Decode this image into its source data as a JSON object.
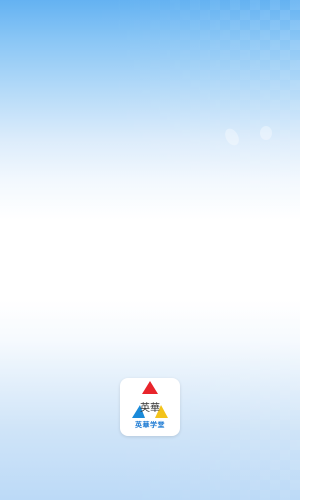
{
  "splash": {
    "app_name": "英華学堂",
    "logo_glyphs": "英華"
  },
  "colors": {
    "brand_blue": "#1e7bd3",
    "logo_red": "#e8242b",
    "logo_blue": "#1a8ad9",
    "logo_yellow": "#f3c31b",
    "background_top": "#64b2f2"
  },
  "icons": [
    "app-logo-icon"
  ]
}
